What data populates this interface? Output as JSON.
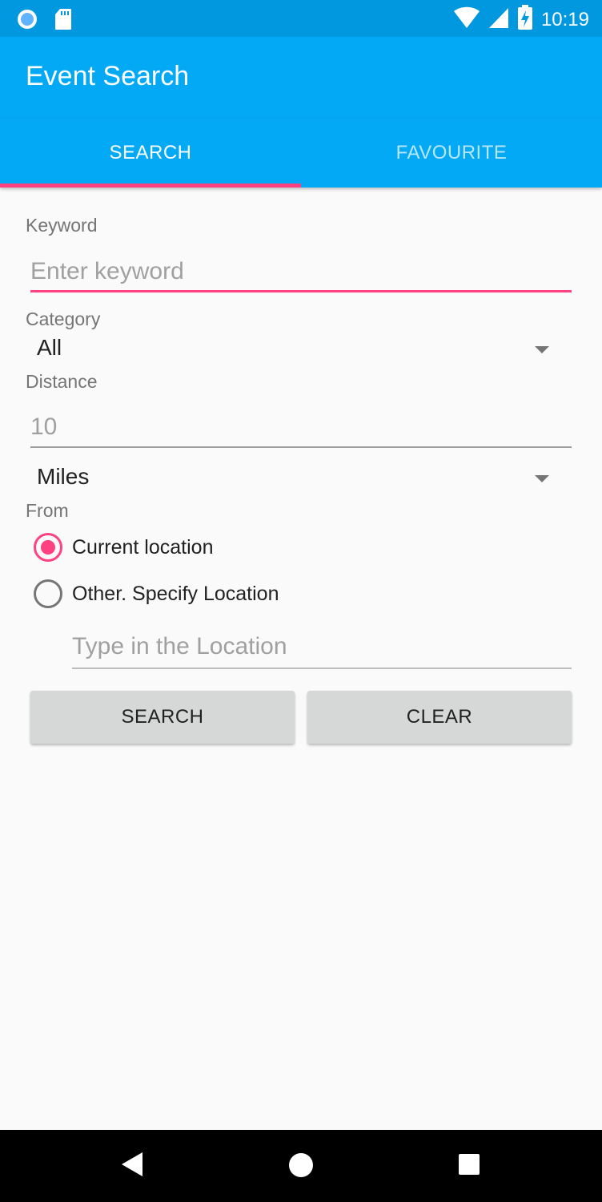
{
  "status_bar": {
    "time": "10:19",
    "icons_left": [
      "circle-notification-icon",
      "sd-card-icon"
    ],
    "icons_right": [
      "wifi-icon",
      "cell-signal-icon",
      "battery-charging-icon"
    ]
  },
  "app_bar": {
    "title": "Event Search"
  },
  "tabs": [
    {
      "label": "SEARCH",
      "active": true
    },
    {
      "label": "FAVOURITE",
      "active": false
    }
  ],
  "form": {
    "keyword": {
      "label": "Keyword",
      "value": "",
      "placeholder": "Enter keyword"
    },
    "category": {
      "label": "Category",
      "selected": "All"
    },
    "distance": {
      "label": "Distance",
      "value": "",
      "placeholder": "10"
    },
    "unit": {
      "selected": "Miles"
    },
    "from": {
      "label": "From",
      "options": [
        {
          "label": "Current location",
          "checked": true
        },
        {
          "label": "Other. Specify Location",
          "checked": false
        }
      ]
    },
    "location": {
      "value": "",
      "placeholder": "Type in the Location"
    }
  },
  "buttons": {
    "search": "SEARCH",
    "clear": "CLEAR"
  },
  "nav_bar": {
    "icons": [
      "back-icon",
      "home-icon",
      "recents-icon"
    ]
  },
  "colors": {
    "primary": "#03A9F4",
    "primary_dark": "#0298E0",
    "accent": "#FF4081",
    "background": "#FAFAFA"
  }
}
